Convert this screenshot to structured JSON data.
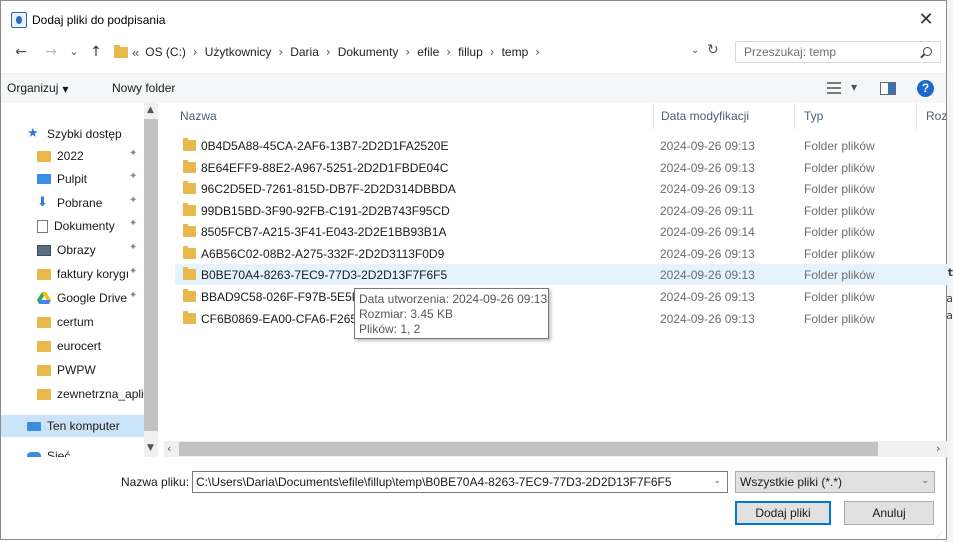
{
  "title": "Dodaj pliki do podpisania",
  "close_glyph": "✕",
  "nav": {
    "back": "←",
    "forward": "→",
    "recent": "⌄",
    "up": "↑",
    "laquo": "«",
    "breadcrumbs": [
      "OS (C:)",
      "Użytkownicy",
      "Daria",
      "Dokumenty",
      "efile",
      "fillup",
      "temp"
    ],
    "separator": "›",
    "dropdown": "⌄",
    "refresh": "↻",
    "search_placeholder": "Przeszukaj: temp"
  },
  "toolbar": {
    "organize": "Organizuj",
    "new_folder": "Nowy folder",
    "help": "?"
  },
  "sidebar": {
    "items": [
      {
        "label": "Szybki dostęp",
        "icon": "star-icon",
        "pinned": false
      },
      {
        "label": "2022",
        "icon": "folder-icon",
        "pinned": true
      },
      {
        "label": "Pulpit",
        "icon": "desktop-icon",
        "pinned": true
      },
      {
        "label": "Pobrane",
        "icon": "download-icon",
        "pinned": true
      },
      {
        "label": "Dokumenty",
        "icon": "documents-icon",
        "pinned": true
      },
      {
        "label": "Obrazy",
        "icon": "pictures-icon",
        "pinned": true
      },
      {
        "label": "faktury korygı",
        "icon": "folder-icon",
        "pinned": true
      },
      {
        "label": "Google Drive",
        "icon": "google-drive-icon",
        "pinned": true
      },
      {
        "label": "certum",
        "icon": "folder-icon",
        "pinned": false
      },
      {
        "label": "eurocert",
        "icon": "folder-icon",
        "pinned": false
      },
      {
        "label": "PWPW",
        "icon": "folder-icon",
        "pinned": false
      },
      {
        "label": "zewnetrzna_aplik",
        "icon": "folder-icon",
        "pinned": false
      },
      {
        "label": "Ten komputer",
        "icon": "computer-icon",
        "pinned": false
      },
      {
        "label": "Sieć",
        "icon": "network-icon",
        "pinned": false
      }
    ],
    "pin_glyph": "📌"
  },
  "columns": {
    "name": "Nazwa",
    "modified": "Data modyfikacji",
    "type": "Typ",
    "size": "Rozn"
  },
  "files": [
    {
      "name": "0B4D5A88-45CA-2AF6-13B7-2D2D1FA2520E",
      "modified": "2024-09-26 09:13",
      "type": "Folder plików"
    },
    {
      "name": "8E64EFF9-88E2-A967-5251-2D2D1FBDE04C",
      "modified": "2024-09-26 09:13",
      "type": "Folder plików"
    },
    {
      "name": "96C2D5ED-7261-815D-DB7F-2D2D314DBBDA",
      "modified": "2024-09-26 09:13",
      "type": "Folder plików"
    },
    {
      "name": "99DB15BD-3F90-92FB-C191-2D2B743F95CD",
      "modified": "2024-09-26 09:11",
      "type": "Folder plików"
    },
    {
      "name": "8505FCB7-A215-3F41-E043-2D2E1BB93B1A",
      "modified": "2024-09-26 09:14",
      "type": "Folder plików"
    },
    {
      "name": "A6B56C02-08B2-A275-332F-2D2D3113F0D9",
      "modified": "2024-09-26 09:13",
      "type": "Folder plików"
    },
    {
      "name": "B0BE70A4-8263-7EC9-77D3-2D2D13F7F6F5",
      "modified": "2024-09-26 09:13",
      "type": "Folder plików"
    },
    {
      "name": "BBAD9C58-026F-F97B-5E5F-",
      "modified": "2024-09-26 09:13",
      "type": "Folder plików"
    },
    {
      "name": "CF6B0869-EA00-CFA6-F265-2",
      "modified": "2024-09-26 09:13",
      "type": "Folder plików"
    }
  ],
  "tooltip": {
    "created": "Data utworzenia: 2024-09-26 09:13",
    "size": "Rozmiar: 3.45 KB",
    "files": "Plików: 1, 2"
  },
  "bottom": {
    "filename_label": "Nazwa pliku:",
    "filename_value": "C:\\Users\\Daria\\Documents\\efile\\fillup\\temp\\B0BE70A4-8263-7EC9-77D3-2D2D13F7F6F5",
    "filetype": "Wszystkie pliki (*.*)",
    "add_button": "Dodaj pliki",
    "cancel_button": "Anuluj"
  },
  "background_fragments": [
    "t",
    "a",
    "va"
  ],
  "colors": {
    "accent": "#0078d7",
    "folder": "#e8b84a",
    "hover_row": "#e5f3ff",
    "selected_sidebar": "#cce4f7",
    "header_text": "#4c607a"
  }
}
